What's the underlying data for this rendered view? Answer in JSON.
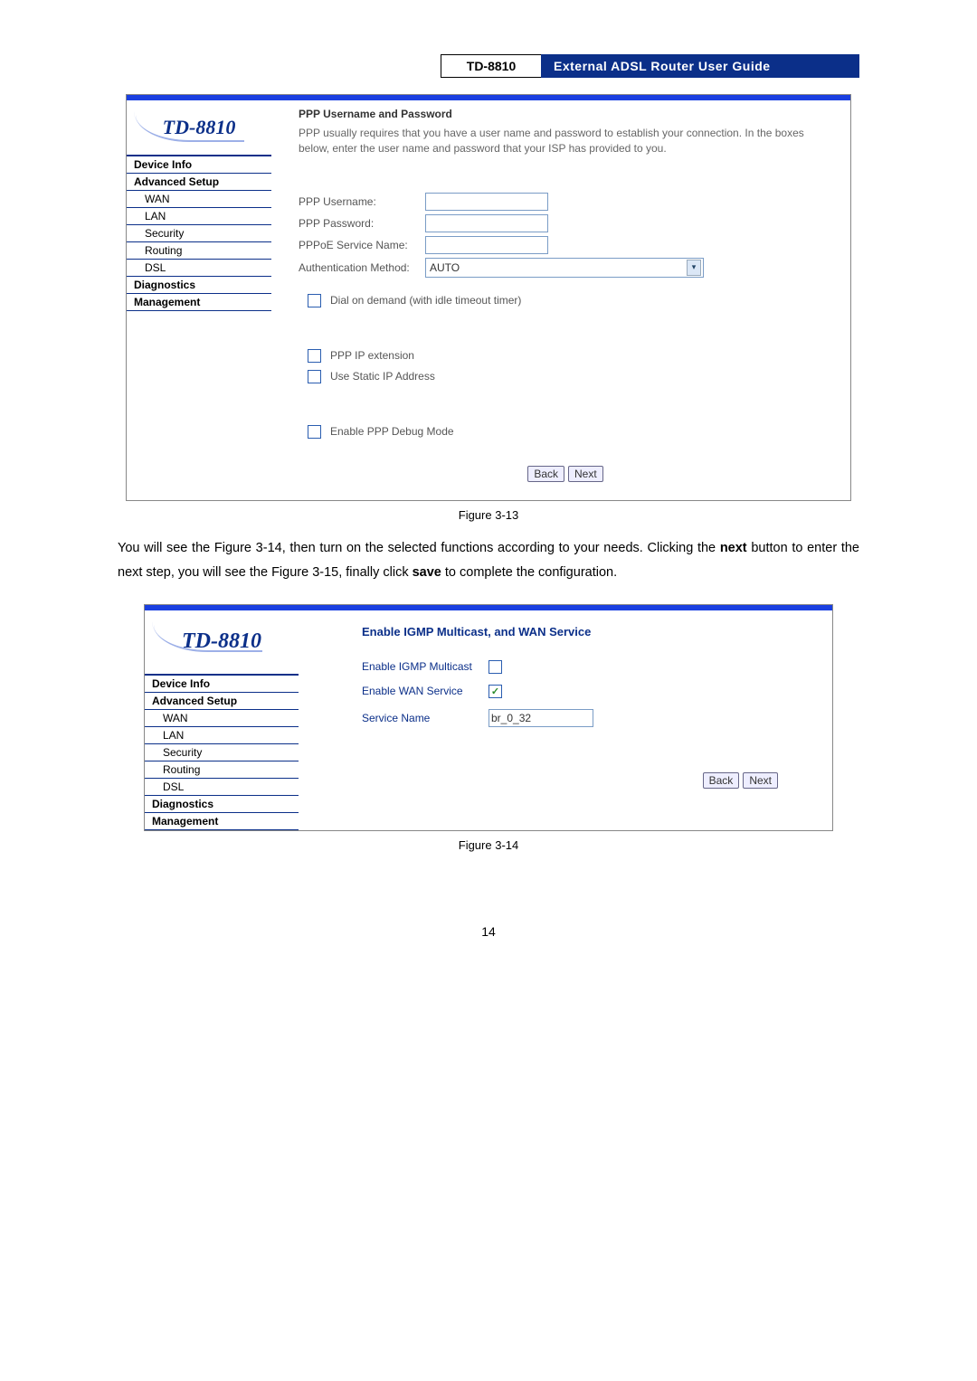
{
  "header": {
    "model": "TD-8810",
    "title": "External ADSL Router User Guide"
  },
  "screenshot1": {
    "logo": "TD-8810",
    "nav": {
      "device_info": "Device Info",
      "advanced_setup": "Advanced Setup",
      "wan": "WAN",
      "lan": "LAN",
      "security": "Security",
      "routing": "Routing",
      "dsl": "DSL",
      "diagnostics": "Diagnostics",
      "management": "Management"
    },
    "content": {
      "title": "PPP Username and Password",
      "desc": "PPP usually requires that you have a user name and password to establish your connection. In the boxes below, enter the user name and password that your ISP has provided to you.",
      "ppp_username_label": "PPP Username:",
      "ppp_password_label": "PPP Password:",
      "pppoe_service_label": "PPPoE Service Name:",
      "auth_method_label": "Authentication Method:",
      "auth_method_value": "AUTO",
      "dial_on_demand": "Dial on demand (with idle timeout timer)",
      "ppp_ip_ext": "PPP IP extension",
      "use_static_ip": "Use Static IP Address",
      "enable_debug": "Enable PPP Debug Mode",
      "back": "Back",
      "next": "Next"
    }
  },
  "caption1": "Figure 3-13",
  "body_text_parts": {
    "p1": "You will see the Figure 3-14, then turn on the selected functions according to your needs. Clicking the ",
    "b1": "next",
    "p2": " button to enter the next step, you will see the Figure 3-15, finally click ",
    "b2": "save",
    "p3": " to complete the configuration."
  },
  "screenshot2": {
    "logo": "TD-8810",
    "nav": {
      "device_info": "Device Info",
      "advanced_setup": "Advanced Setup",
      "wan": "WAN",
      "lan": "LAN",
      "security": "Security",
      "routing": "Routing",
      "dsl": "DSL",
      "diagnostics": "Diagnostics",
      "management": "Management"
    },
    "content": {
      "title": "Enable IGMP Multicast, and WAN Service",
      "enable_igmp": "Enable IGMP Multicast",
      "enable_wan": "Enable WAN Service",
      "service_name_label": "Service Name",
      "service_name_value": "br_0_32",
      "back": "Back",
      "next": "Next"
    }
  },
  "caption2": "Figure 3-14",
  "page_number": "14"
}
